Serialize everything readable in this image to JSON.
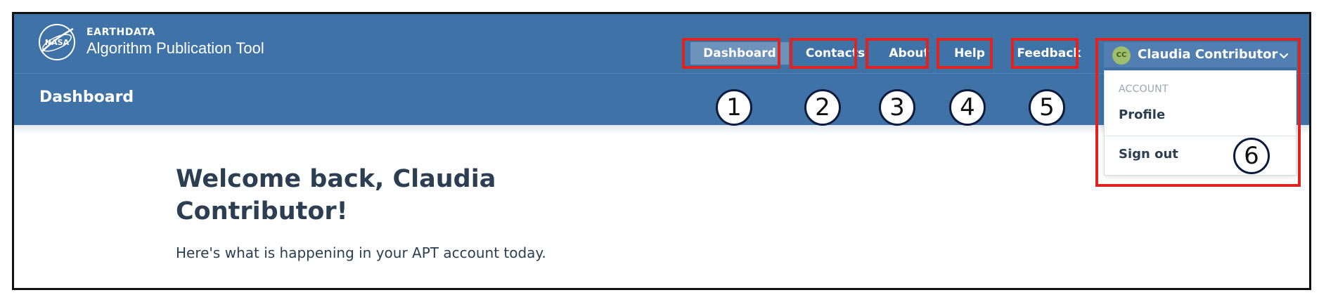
{
  "brand": {
    "small": "EARTHDATA",
    "large": "Algorithm Publication Tool",
    "logo_icon": "nasa-meatball-logo",
    "logo_text": "NASA"
  },
  "nav": {
    "items": [
      {
        "label": "Dashboard",
        "active": true
      },
      {
        "label": "Contacts"
      },
      {
        "label": "About"
      },
      {
        "label": "Help"
      },
      {
        "label": "Feedback"
      }
    ]
  },
  "user": {
    "initials": "CC",
    "name": "Claudia Contributor",
    "menu_icon": "chevron-down-icon",
    "dropdown": {
      "heading": "ACCOUNT",
      "items": [
        "Profile",
        "Sign out"
      ]
    }
  },
  "page": {
    "title": "Dashboard"
  },
  "welcome": {
    "title": "Welcome back, Claudia Contributor!",
    "subtitle": "Here's what is happening in your APT account today."
  },
  "annotations": [
    "1",
    "2",
    "3",
    "4",
    "5",
    "6"
  ],
  "colors": {
    "header_bg": "#3f72a6",
    "active_nav_bg": "#6d93bd",
    "annotation_red": "#e0231f",
    "text_dark": "#2c3e52"
  }
}
